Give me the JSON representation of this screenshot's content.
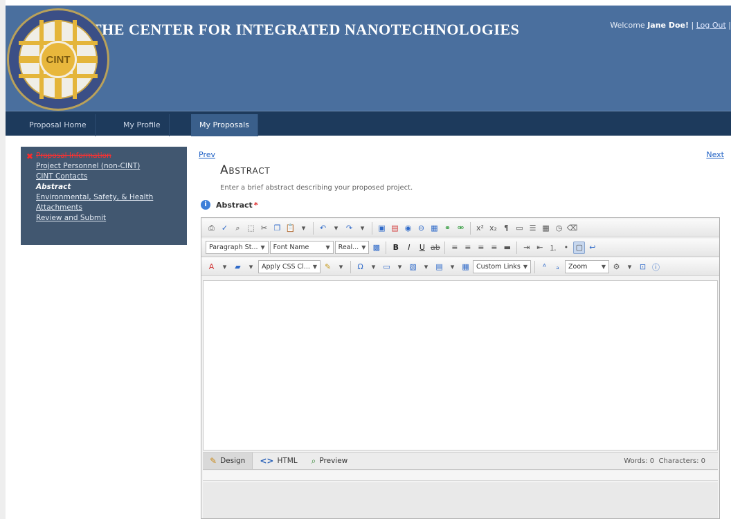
{
  "header": {
    "site_title": "The Center for Integrated Nanotechnologies",
    "logo_text": "CINT",
    "welcome_prefix": "Welcome ",
    "user_name": "Jane Doe!",
    "separator": " | ",
    "logout_label": "Log Out",
    "trailing": " |"
  },
  "nav": {
    "items": [
      {
        "label": "Proposal Home"
      },
      {
        "label": "My Profile"
      },
      {
        "label": "My Proposals"
      }
    ]
  },
  "sidebar": {
    "items": [
      {
        "label": "Proposal Information",
        "state": "error"
      },
      {
        "label": "Project Personnel (non-CINT)"
      },
      {
        "label": "CINT Contacts"
      },
      {
        "label": "Abstract",
        "state": "current"
      },
      {
        "label": "Environmental, Safety, & Health"
      },
      {
        "label": "Attachments"
      },
      {
        "label": "Review and Submit"
      }
    ]
  },
  "content": {
    "prev_label": "Prev",
    "next_label": "Next",
    "section_title": "Abstract",
    "instructions": "Enter a brief abstract describing your proposed project.",
    "field_label": "Abstract",
    "required_marker": "*"
  },
  "editor": {
    "dropdowns": {
      "paragraph_style": "Paragraph St...",
      "font_name": "Font Name",
      "font_size": "Real...",
      "css_class": "Apply CSS Cl...",
      "custom_links": "Custom Links",
      "zoom": "Zoom"
    },
    "modes": [
      {
        "label": "Design",
        "icon": "pencil-icon"
      },
      {
        "label": "HTML",
        "icon": "html-icon"
      },
      {
        "label": "Preview",
        "icon": "magnifier-icon"
      }
    ],
    "counts": {
      "words": "Words: 0",
      "characters": "Characters: 0"
    }
  },
  "colors": {
    "header_bg": "#4a6f9e",
    "nav_bg": "#1d3a5c",
    "sidebar_bg": "#415770",
    "link": "#1d5fc4",
    "error": "#ff3030"
  }
}
